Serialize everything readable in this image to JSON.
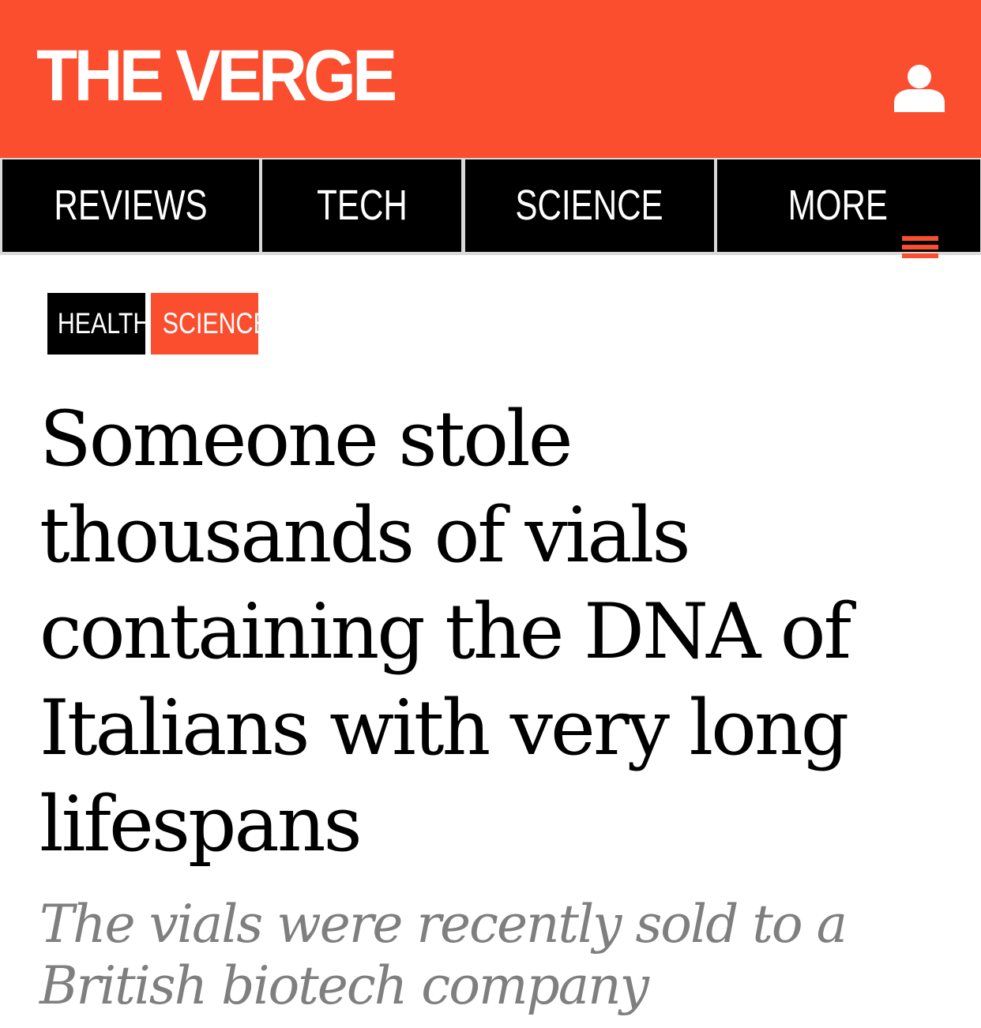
{
  "header": {
    "logo_text": "THE VERGE",
    "account_icon": "user-icon"
  },
  "nav": {
    "items": [
      {
        "label": "REVIEWS"
      },
      {
        "label": "TECH"
      },
      {
        "label": "SCIENCE"
      },
      {
        "label": "MORE",
        "icon": "hamburger-menu-icon"
      }
    ]
  },
  "tags": [
    {
      "label": "HEALTH"
    },
    {
      "label": "SCIENCE"
    }
  ],
  "article": {
    "headline": "Someone stole thousands of vials containing the DNA of Italians with very long lifespans",
    "dek": "The vials were recently sold to a British biotech company"
  },
  "colors": {
    "brand": "#fa4e2e",
    "nav_background": "#000000",
    "dek_text": "#7f7f7f"
  }
}
